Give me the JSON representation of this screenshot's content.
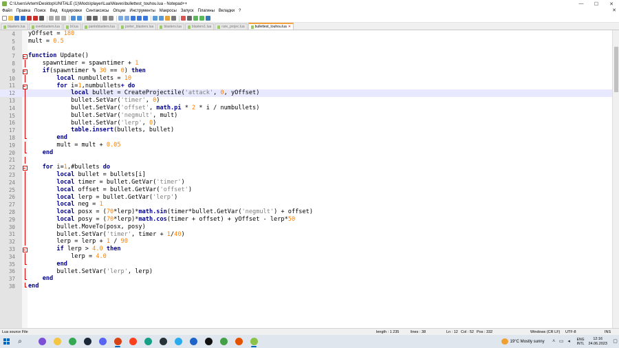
{
  "window": {
    "title": "C:\\Users\\Artem\\Desktop\\UNITALE (1)\\Mods\\player\\Lua\\Waves\\bullettest_touhou.lua - Notepad++",
    "controls": [
      "—",
      "☐",
      "✕"
    ]
  },
  "menu": {
    "items": [
      "Файл",
      "Правка",
      "Поиск",
      "Вид",
      "Кодировки",
      "Синтаксисы",
      "Опции",
      "Инструменты",
      "Макросы",
      "Запуск",
      "Плагины",
      "Вкладки",
      "?"
    ],
    "right_symbol": "✕"
  },
  "tabs": [
    {
      "label": "blasters.lua",
      "active": false
    },
    {
      "label": "overblasters.lua",
      "active": false
    },
    {
      "label": "bl.lua",
      "active": false
    },
    {
      "label": "pantoblasters.lua",
      "active": false
    },
    {
      "label": "porter_blasters.lua",
      "active": false
    },
    {
      "label": "blasters.lua",
      "active": false
    },
    {
      "label": "blasters1.lua",
      "active": false
    },
    {
      "label": "rare_projec.lua",
      "active": false
    },
    {
      "label": "bullettest_touhou.lua",
      "active": true
    }
  ],
  "editor": {
    "current_line": 12,
    "lines": [
      {
        "n": 4,
        "fold": "none",
        "tokens": [
          [
            "t",
            "yOffset = "
          ],
          [
            "num",
            "180"
          ]
        ]
      },
      {
        "n": 5,
        "fold": "none",
        "tokens": [
          [
            "t",
            "mult = "
          ],
          [
            "num",
            "0.5"
          ]
        ]
      },
      {
        "n": 6,
        "fold": "none",
        "tokens": []
      },
      {
        "n": 7,
        "fold": "box",
        "tokens": [
          [
            "kw",
            "function"
          ],
          [
            "t",
            " Update()"
          ]
        ]
      },
      {
        "n": 8,
        "fold": "vline",
        "tokens": [
          [
            "t",
            "    spawntimer = spawntimer + "
          ],
          [
            "num",
            "1"
          ]
        ]
      },
      {
        "n": 9,
        "fold": "box",
        "tokens": [
          [
            "t",
            "    "
          ],
          [
            "kw",
            "if"
          ],
          [
            "t",
            "(spawntimer % "
          ],
          [
            "num",
            "30"
          ],
          [
            "t",
            " == "
          ],
          [
            "num",
            "0"
          ],
          [
            "t",
            ") "
          ],
          [
            "kw",
            "then"
          ]
        ]
      },
      {
        "n": 10,
        "fold": "vline",
        "tokens": [
          [
            "t",
            "        "
          ],
          [
            "kw",
            "local"
          ],
          [
            "t",
            " numbullets = "
          ],
          [
            "num",
            "10"
          ]
        ]
      },
      {
        "n": 11,
        "fold": "box",
        "tokens": [
          [
            "t",
            "        "
          ],
          [
            "kw",
            "for"
          ],
          [
            "t",
            " i="
          ],
          [
            "num",
            "1"
          ],
          [
            "t",
            ",numbullets"
          ],
          [
            "kw",
            "+"
          ],
          [
            "t",
            " "
          ],
          [
            "kw",
            "do"
          ]
        ]
      },
      {
        "n": 12,
        "fold": "vline",
        "tokens": [
          [
            "t",
            "            "
          ],
          [
            "kw",
            "local"
          ],
          [
            "t",
            " bullet = CreateProjectile("
          ],
          [
            "str",
            "'attack'"
          ],
          [
            "t",
            ", "
          ],
          [
            "num",
            "0"
          ],
          [
            "t",
            ", yOffset)"
          ]
        ]
      },
      {
        "n": 13,
        "fold": "vline",
        "tokens": [
          [
            "t",
            "            bullet.SetVar("
          ],
          [
            "str",
            "'timer'"
          ],
          [
            "t",
            ", "
          ],
          [
            "num",
            "0"
          ],
          [
            "t",
            ")"
          ]
        ]
      },
      {
        "n": 14,
        "fold": "vline",
        "tokens": [
          [
            "t",
            "            bullet.SetVar("
          ],
          [
            "str",
            "'offset'"
          ],
          [
            "t",
            ", "
          ],
          [
            "lib",
            "math.pi"
          ],
          [
            "t",
            " * "
          ],
          [
            "num",
            "2"
          ],
          [
            "t",
            " * i / numbullets)"
          ]
        ]
      },
      {
        "n": 15,
        "fold": "vline",
        "tokens": [
          [
            "t",
            "            bullet.SetVar("
          ],
          [
            "str",
            "'negmult'"
          ],
          [
            "t",
            ", mult)"
          ]
        ]
      },
      {
        "n": 16,
        "fold": "vline",
        "tokens": [
          [
            "t",
            "            bullet.SetVar("
          ],
          [
            "str",
            "'lerp'"
          ],
          [
            "t",
            ", "
          ],
          [
            "num",
            "0"
          ],
          [
            "t",
            ")"
          ]
        ]
      },
      {
        "n": 17,
        "fold": "vline",
        "tokens": [
          [
            "t",
            "            "
          ],
          [
            "lib",
            "table.insert"
          ],
          [
            "t",
            "(bullets, bullet)"
          ]
        ]
      },
      {
        "n": 18,
        "fold": "end",
        "tokens": [
          [
            "t",
            "        "
          ],
          [
            "kw",
            "end"
          ]
        ]
      },
      {
        "n": 19,
        "fold": "vline",
        "tokens": [
          [
            "t",
            "        mult = mult + "
          ],
          [
            "num",
            "0.05"
          ]
        ]
      },
      {
        "n": 20,
        "fold": "end",
        "tokens": [
          [
            "t",
            "    "
          ],
          [
            "kw",
            "end"
          ]
        ]
      },
      {
        "n": 21,
        "fold": "vline",
        "tokens": []
      },
      {
        "n": 22,
        "fold": "box",
        "tokens": [
          [
            "t",
            "    "
          ],
          [
            "kw",
            "for"
          ],
          [
            "t",
            " i="
          ],
          [
            "num",
            "1"
          ],
          [
            "t",
            ",#bullets "
          ],
          [
            "kw",
            "do"
          ]
        ]
      },
      {
        "n": 23,
        "fold": "vline",
        "tokens": [
          [
            "t",
            "        "
          ],
          [
            "kw",
            "local"
          ],
          [
            "t",
            " bullet = bullets[i]"
          ]
        ]
      },
      {
        "n": 24,
        "fold": "vline",
        "tokens": [
          [
            "t",
            "        "
          ],
          [
            "kw",
            "local"
          ],
          [
            "t",
            " timer = bullet.GetVar("
          ],
          [
            "str",
            "'timer'"
          ],
          [
            "t",
            ")"
          ]
        ]
      },
      {
        "n": 25,
        "fold": "vline",
        "tokens": [
          [
            "t",
            "        "
          ],
          [
            "kw",
            "local"
          ],
          [
            "t",
            " offset = bullet.GetVar("
          ],
          [
            "str",
            "'offset'"
          ],
          [
            "t",
            ")"
          ]
        ]
      },
      {
        "n": 26,
        "fold": "vline",
        "tokens": [
          [
            "t",
            "        "
          ],
          [
            "kw",
            "local"
          ],
          [
            "t",
            " lerp = bullet.GetVar("
          ],
          [
            "str",
            "'lerp'"
          ],
          [
            "t",
            ")"
          ]
        ]
      },
      {
        "n": 27,
        "fold": "vline",
        "tokens": [
          [
            "t",
            "        "
          ],
          [
            "kw",
            "local"
          ],
          [
            "t",
            " neg = "
          ],
          [
            "num",
            "1"
          ]
        ]
      },
      {
        "n": 28,
        "fold": "vline",
        "tokens": [
          [
            "t",
            "        "
          ],
          [
            "kw",
            "local"
          ],
          [
            "t",
            " posx = ("
          ],
          [
            "num",
            "70"
          ],
          [
            "t",
            "*lerp)*"
          ],
          [
            "lib",
            "math.sin"
          ],
          [
            "t",
            "(timer*bullet.GetVar("
          ],
          [
            "str",
            "'negmult'"
          ],
          [
            "t",
            ") + offset)"
          ]
        ]
      },
      {
        "n": 29,
        "fold": "vline",
        "tokens": [
          [
            "t",
            "        "
          ],
          [
            "kw",
            "local"
          ],
          [
            "t",
            " posy = ("
          ],
          [
            "num",
            "70"
          ],
          [
            "t",
            "*lerp)*"
          ],
          [
            "lib",
            "math.cos"
          ],
          [
            "t",
            "(timer + offset) + yOffset - lerp*"
          ],
          [
            "num",
            "50"
          ]
        ]
      },
      {
        "n": 30,
        "fold": "vline",
        "tokens": [
          [
            "t",
            "        bullet.MoveTo(posx, posy)"
          ]
        ]
      },
      {
        "n": 31,
        "fold": "vline",
        "tokens": [
          [
            "t",
            "        bullet.SetVar("
          ],
          [
            "str",
            "'timer'"
          ],
          [
            "t",
            ", timer + "
          ],
          [
            "num",
            "1"
          ],
          [
            "t",
            "/"
          ],
          [
            "num",
            "40"
          ],
          [
            "t",
            ")"
          ]
        ]
      },
      {
        "n": 32,
        "fold": "vline",
        "tokens": [
          [
            "t",
            "        lerp = lerp + "
          ],
          [
            "num",
            "1"
          ],
          [
            "t",
            " / "
          ],
          [
            "num",
            "90"
          ]
        ]
      },
      {
        "n": 33,
        "fold": "box",
        "tokens": [
          [
            "t",
            "        "
          ],
          [
            "kw",
            "if"
          ],
          [
            "t",
            " lerp > "
          ],
          [
            "num",
            "4.0"
          ],
          [
            "t",
            " "
          ],
          [
            "kw",
            "then"
          ]
        ]
      },
      {
        "n": 34,
        "fold": "vline",
        "tokens": [
          [
            "t",
            "            lerp = "
          ],
          [
            "num",
            "4.0"
          ]
        ]
      },
      {
        "n": 35,
        "fold": "end",
        "tokens": [
          [
            "t",
            "        "
          ],
          [
            "kw",
            "end"
          ]
        ]
      },
      {
        "n": 36,
        "fold": "vline",
        "tokens": [
          [
            "t",
            "        bullet.SetVar("
          ],
          [
            "str",
            "'lerp'"
          ],
          [
            "t",
            ", lerp)"
          ]
        ]
      },
      {
        "n": 37,
        "fold": "end",
        "tokens": [
          [
            "t",
            "    "
          ],
          [
            "kw",
            "end"
          ]
        ]
      },
      {
        "n": 38,
        "fold": "end",
        "tokens": [
          [
            "kw",
            "end"
          ]
        ]
      }
    ]
  },
  "status": {
    "file_type": "Lua source File",
    "length": "length : 1 235",
    "lines": "lines : 38",
    "cursor_line": "Ln : 12",
    "cursor_col": "Col : 52",
    "cursor_pos": "Pos : 332",
    "eol": "Windows (CR LF)",
    "encoding": "UTF-8",
    "mode": "INS"
  },
  "taskbar": {
    "apps": [
      {
        "name": "browser-purple",
        "color": "#7b4fd6",
        "active": false
      },
      {
        "name": "file-explorer",
        "color": "#f4c542",
        "active": false
      },
      {
        "name": "chrome",
        "color": "#34a853",
        "active": false
      },
      {
        "name": "steam",
        "color": "#1b2838",
        "active": false
      },
      {
        "name": "discord",
        "color": "#5865f2",
        "active": false
      },
      {
        "name": "app-red",
        "color": "#d84315",
        "active": true
      },
      {
        "name": "yandex",
        "color": "#fc3f1d",
        "active": false
      },
      {
        "name": "app-teal",
        "color": "#16a085",
        "active": false
      },
      {
        "name": "app-dark",
        "color": "#263238",
        "active": false
      },
      {
        "name": "telegram",
        "color": "#2aabee",
        "active": false
      },
      {
        "name": "app-blue",
        "color": "#1e63c8",
        "active": false
      },
      {
        "name": "tiktok",
        "color": "#111111",
        "active": false
      },
      {
        "name": "app-green",
        "color": "#43a047",
        "active": false
      },
      {
        "name": "app-orange",
        "color": "#e65100",
        "active": false
      },
      {
        "name": "notepad-plus-plus",
        "color": "#8bc34a",
        "active": true
      }
    ],
    "weather": "19°C  Mostly sunny",
    "lang_top": "ENG",
    "lang_bottom": "INTL",
    "time": "12:16",
    "date": "24.06.2023"
  }
}
